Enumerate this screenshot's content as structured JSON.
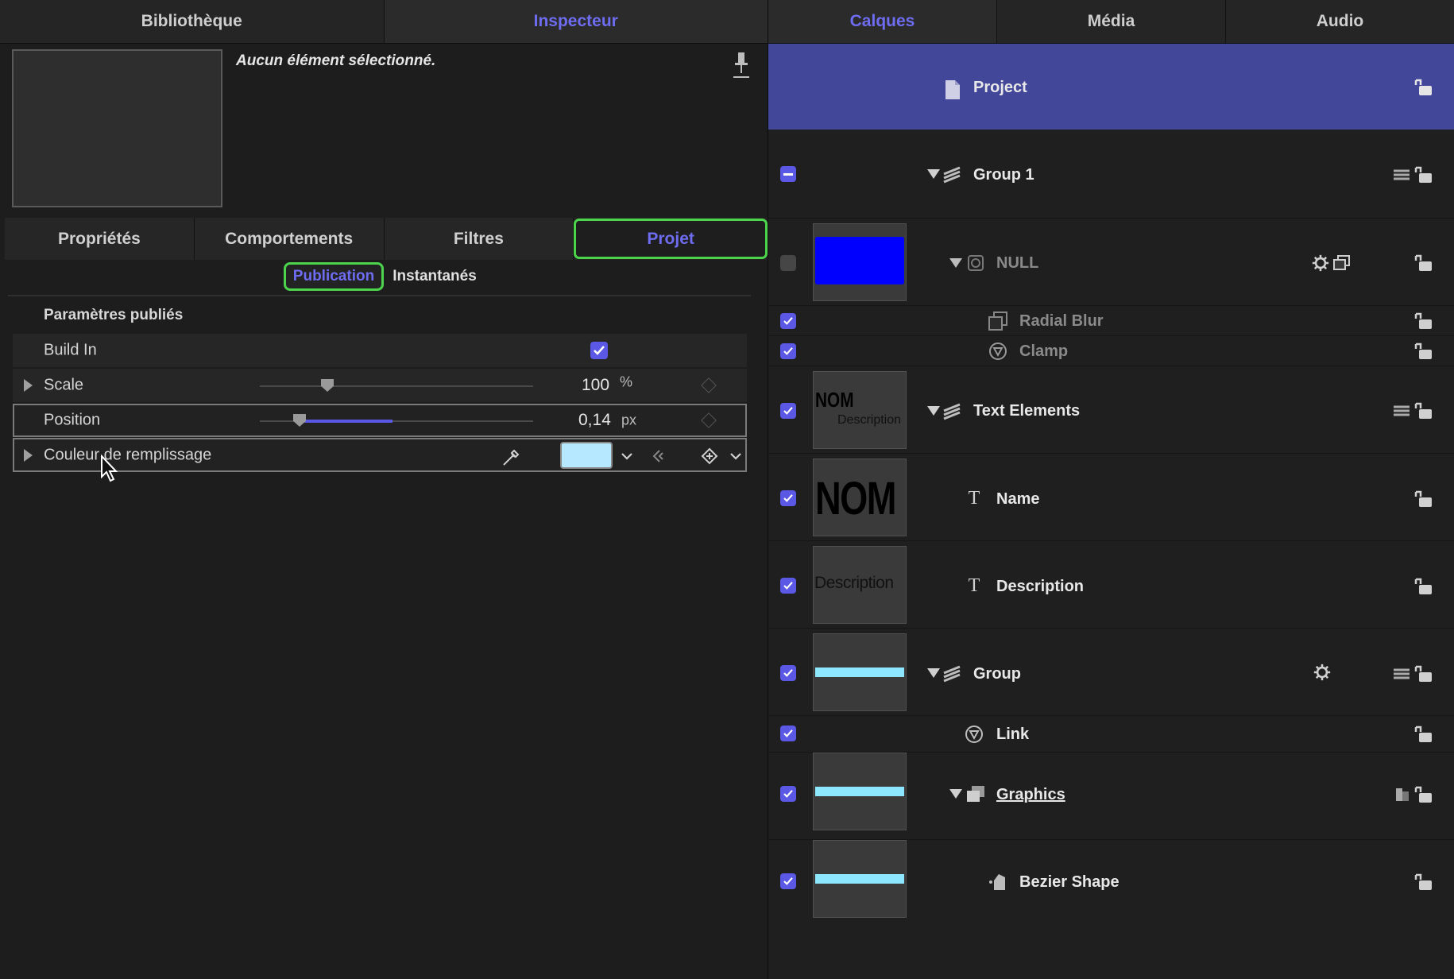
{
  "left_tabs": [
    "Bibliothèque",
    "Inspecteur"
  ],
  "right_tabs": [
    "Calques",
    "Média",
    "Audio"
  ],
  "inspector": {
    "no_selection": "Aucun élément sélectionné.",
    "sub_tabs": [
      "Propriétés",
      "Comportements",
      "Filtres",
      "Projet"
    ],
    "segments": [
      "Publication",
      "Instantanés"
    ],
    "section_title": "Paramètres publiés",
    "params": {
      "build_in": {
        "label": "Build In",
        "checked": true
      },
      "scale": {
        "label": "Scale",
        "value": "100",
        "unit": "%",
        "slider_fraction": 0.26
      },
      "position": {
        "label": "Position",
        "value": "0,14",
        "unit": "px",
        "slider_fraction": 0.41
      },
      "fill_color": {
        "label": "Couleur de remplissage",
        "color": "#b6e9ff"
      }
    }
  },
  "layers": {
    "project": "Project",
    "items": [
      {
        "name": "Group 1",
        "checked": "minus"
      },
      {
        "name": "NULL",
        "checked": "off"
      },
      {
        "name": "Radial Blur",
        "checked": "on"
      },
      {
        "name": "Clamp",
        "checked": "on"
      },
      {
        "name": "Text Elements",
        "checked": "on"
      },
      {
        "name": "Name",
        "checked": "on"
      },
      {
        "name": "Description",
        "checked": "on"
      },
      {
        "name": "Group",
        "checked": "on"
      },
      {
        "name": "Link",
        "checked": "on"
      },
      {
        "name": "Graphics",
        "checked": "on"
      },
      {
        "name": "Bezier Shape",
        "checked": "on"
      }
    ],
    "thumb_texts": {
      "nom": "NOM",
      "description": "Description"
    }
  },
  "colors": {
    "accent": "#5b58e6",
    "highlight": "#4cd44c",
    "project_bar": "#43479a",
    "null_thumb": "#0000ff",
    "shape_thumb": "#8de8ff"
  }
}
